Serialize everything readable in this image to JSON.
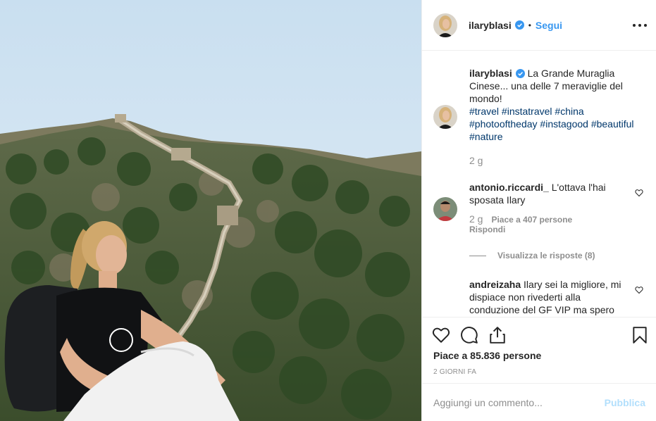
{
  "post": {
    "username": "ilaryblasi",
    "follow_label": "Segui",
    "dot": "•"
  },
  "caption": {
    "username": "ilaryblasi",
    "text": "La Grande Muraglia Cinese... una delle 7 meraviglie del mondo!",
    "hashtags": [
      "#travel",
      "#instatravel",
      "#china",
      "#photooftheday",
      "#instagood",
      "#beautiful",
      "#nature"
    ],
    "time": "2 g"
  },
  "comments": [
    {
      "username": "antonio.riccardi_",
      "text": "L'ottava l'hai sposata Ilary",
      "time": "2 g",
      "likes": "Piace a 407 persone",
      "reply_label": "Rispondi"
    },
    {
      "username": "andreizaha",
      "text": "Ilary sei la migliore, mi dispiace non rivederti alla conduzione del GF VIP ma spero"
    }
  ],
  "view_replies": "Visualizza le risposte (8)",
  "likes_total": "Piace a 85.836 persone",
  "date": "2 GIORNI FA",
  "add_comment": {
    "placeholder": "Aggiungi un commento...",
    "publish_label": "Pubblica"
  },
  "colors": {
    "accent": "#3897f0",
    "hashtag": "#00376b",
    "muted": "#8e8e8e",
    "publish_disabled": "#b2dffc"
  },
  "icons": [
    "verified-badge-icon",
    "more-options-icon",
    "heart-icon",
    "comment-icon",
    "share-icon",
    "bookmark-icon",
    "small-heart-icon"
  ]
}
